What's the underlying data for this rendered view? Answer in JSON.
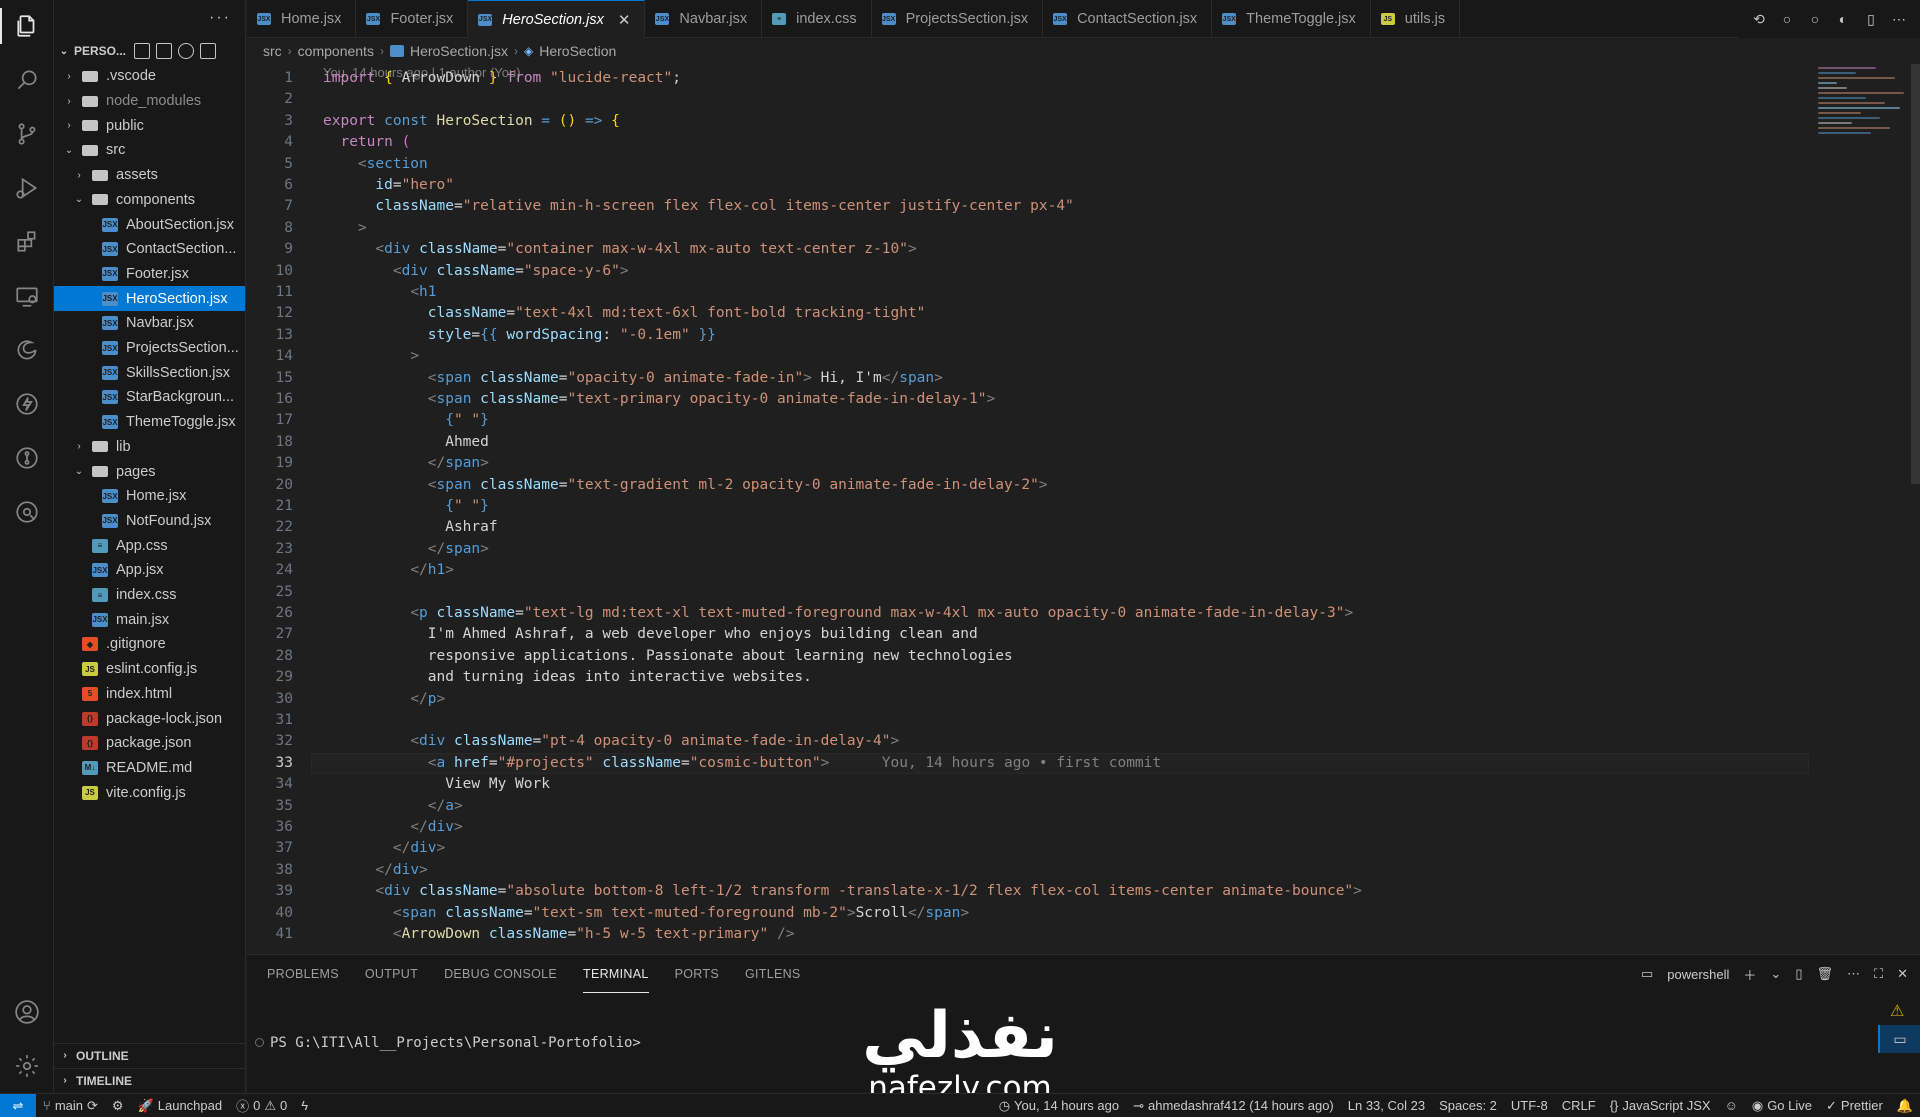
{
  "sidebar": {
    "title_dots": "···",
    "root_label": "PERSO...",
    "tree": [
      {
        "label": ".vscode",
        "kind": "folder",
        "indent": 0,
        "open": false
      },
      {
        "label": "node_modules",
        "kind": "folder",
        "indent": 0,
        "open": false,
        "dim": true
      },
      {
        "label": "public",
        "kind": "folder",
        "indent": 0,
        "open": false
      },
      {
        "label": "src",
        "kind": "folder",
        "indent": 0,
        "open": true
      },
      {
        "label": "assets",
        "kind": "folder",
        "indent": 1,
        "open": false
      },
      {
        "label": "components",
        "kind": "folder",
        "indent": 1,
        "open": true
      },
      {
        "label": "AboutSection.jsx",
        "kind": "jsx",
        "indent": 2
      },
      {
        "label": "ContactSection...",
        "kind": "jsx",
        "indent": 2
      },
      {
        "label": "Footer.jsx",
        "kind": "jsx",
        "indent": 2
      },
      {
        "label": "HeroSection.jsx",
        "kind": "jsx",
        "indent": 2,
        "selected": true
      },
      {
        "label": "Navbar.jsx",
        "kind": "jsx",
        "indent": 2
      },
      {
        "label": "ProjectsSection...",
        "kind": "jsx",
        "indent": 2
      },
      {
        "label": "SkillsSection.jsx",
        "kind": "jsx",
        "indent": 2
      },
      {
        "label": "StarBackgroun...",
        "kind": "jsx",
        "indent": 2
      },
      {
        "label": "ThemeToggle.jsx",
        "kind": "jsx",
        "indent": 2
      },
      {
        "label": "lib",
        "kind": "folder",
        "indent": 1,
        "open": false
      },
      {
        "label": "pages",
        "kind": "folder",
        "indent": 1,
        "open": true
      },
      {
        "label": "Home.jsx",
        "kind": "jsx",
        "indent": 2
      },
      {
        "label": "NotFound.jsx",
        "kind": "jsx",
        "indent": 2
      },
      {
        "label": "App.css",
        "kind": "css",
        "indent": 1
      },
      {
        "label": "App.jsx",
        "kind": "jsx",
        "indent": 1
      },
      {
        "label": "index.css",
        "kind": "css",
        "indent": 1
      },
      {
        "label": "main.jsx",
        "kind": "jsx",
        "indent": 1
      },
      {
        "label": ".gitignore",
        "kind": "git",
        "indent": 0
      },
      {
        "label": "eslint.config.js",
        "kind": "js",
        "indent": 0
      },
      {
        "label": "index.html",
        "kind": "html",
        "indent": 0
      },
      {
        "label": "package-lock.json",
        "kind": "json",
        "indent": 0
      },
      {
        "label": "package.json",
        "kind": "json",
        "indent": 0
      },
      {
        "label": "README.md",
        "kind": "md",
        "indent": 0
      },
      {
        "label": "vite.config.js",
        "kind": "js",
        "indent": 0
      }
    ],
    "outline_label": "OUTLINE",
    "timeline_label": "TIMELINE"
  },
  "tabs": [
    {
      "label": "Home.jsx",
      "kind": "jsx"
    },
    {
      "label": "Footer.jsx",
      "kind": "jsx"
    },
    {
      "label": "HeroSection.jsx",
      "kind": "jsx",
      "active": true
    },
    {
      "label": "Navbar.jsx",
      "kind": "jsx"
    },
    {
      "label": "index.css",
      "kind": "css"
    },
    {
      "label": "ProjectsSection.jsx",
      "kind": "jsx"
    },
    {
      "label": "ContactSection.jsx",
      "kind": "jsx"
    },
    {
      "label": "ThemeToggle.jsx",
      "kind": "jsx"
    },
    {
      "label": "utils.js",
      "kind": "js"
    }
  ],
  "tab_close_glyph": "✕",
  "breadcrumb": {
    "parts": [
      "src",
      "components",
      "HeroSection.jsx",
      "HeroSection"
    ]
  },
  "editor": {
    "blame_header": "You, 14 hours ago | 1 author (You)",
    "current_line": 33,
    "inline_blame": "You, 14 hours ago • first commit",
    "lines": [
      [
        [
          "k",
          "import"
        ],
        [
          "p",
          " "
        ],
        [
          "br",
          "{"
        ],
        [
          "p",
          " ArrowDown "
        ],
        [
          "br",
          "}"
        ],
        [
          "p",
          " "
        ],
        [
          "k",
          "from"
        ],
        [
          "p",
          " "
        ],
        [
          "s",
          "\"lucide-react\""
        ],
        [
          "p",
          ";"
        ]
      ],
      [],
      [
        [
          "k",
          "export"
        ],
        [
          "p",
          " "
        ],
        [
          "b",
          "const"
        ],
        [
          "p",
          " "
        ],
        [
          "f",
          "HeroSection"
        ],
        [
          "p",
          " "
        ],
        [
          "b",
          "="
        ],
        [
          "p",
          " "
        ],
        [
          "br",
          "()"
        ],
        [
          "p",
          " "
        ],
        [
          "b",
          "=>"
        ],
        [
          "p",
          " "
        ],
        [
          "br",
          "{"
        ]
      ],
      [
        [
          "p",
          "  "
        ],
        [
          "k",
          "return"
        ],
        [
          "p",
          " "
        ],
        [
          "brp",
          "("
        ]
      ],
      [
        [
          "p",
          "    "
        ],
        [
          "tg",
          "<"
        ],
        [
          "t",
          "section"
        ]
      ],
      [
        [
          "p",
          "      "
        ],
        [
          "a",
          "id"
        ],
        [
          "p",
          "="
        ],
        [
          "s",
          "\"hero\""
        ]
      ],
      [
        [
          "p",
          "      "
        ],
        [
          "a",
          "className"
        ],
        [
          "p",
          "="
        ],
        [
          "s",
          "\"relative min-h-screen flex flex-col items-center justify-center px-4\""
        ]
      ],
      [
        [
          "p",
          "    "
        ],
        [
          "tg",
          ">"
        ]
      ],
      [
        [
          "p",
          "      "
        ],
        [
          "tg",
          "<"
        ],
        [
          "t",
          "div"
        ],
        [
          "p",
          " "
        ],
        [
          "a",
          "className"
        ],
        [
          "p",
          "="
        ],
        [
          "s",
          "\"container max-w-4xl mx-auto text-center z-10\""
        ],
        [
          "tg",
          ">"
        ]
      ],
      [
        [
          "p",
          "        "
        ],
        [
          "tg",
          "<"
        ],
        [
          "t",
          "div"
        ],
        [
          "p",
          " "
        ],
        [
          "a",
          "className"
        ],
        [
          "p",
          "="
        ],
        [
          "s",
          "\"space-y-6\""
        ],
        [
          "tg",
          ">"
        ]
      ],
      [
        [
          "p",
          "          "
        ],
        [
          "tg",
          "<"
        ],
        [
          "t",
          "h1"
        ]
      ],
      [
        [
          "p",
          "            "
        ],
        [
          "a",
          "className"
        ],
        [
          "p",
          "="
        ],
        [
          "s",
          "\"text-4xl md:text-6xl font-bold tracking-tight\""
        ]
      ],
      [
        [
          "p",
          "            "
        ],
        [
          "a",
          "style"
        ],
        [
          "p",
          "="
        ],
        [
          "b",
          "{{"
        ],
        [
          "p",
          " "
        ],
        [
          "a",
          "wordSpacing"
        ],
        [
          "p",
          ": "
        ],
        [
          "s",
          "\"-0.1em\""
        ],
        [
          "p",
          " "
        ],
        [
          "b",
          "}}"
        ]
      ],
      [
        [
          "p",
          "          "
        ],
        [
          "tg",
          ">"
        ]
      ],
      [
        [
          "p",
          "            "
        ],
        [
          "tg",
          "<"
        ],
        [
          "t",
          "span"
        ],
        [
          "p",
          " "
        ],
        [
          "a",
          "className"
        ],
        [
          "p",
          "="
        ],
        [
          "s",
          "\"opacity-0 animate-fade-in\""
        ],
        [
          "tg",
          ">"
        ],
        [
          "x",
          " Hi, I'm"
        ],
        [
          "tg",
          "</"
        ],
        [
          "t",
          "span"
        ],
        [
          "tg",
          ">"
        ]
      ],
      [
        [
          "p",
          "            "
        ],
        [
          "tg",
          "<"
        ],
        [
          "t",
          "span"
        ],
        [
          "p",
          " "
        ],
        [
          "a",
          "className"
        ],
        [
          "p",
          "="
        ],
        [
          "s",
          "\"text-primary opacity-0 animate-fade-in-delay-1\""
        ],
        [
          "tg",
          ">"
        ]
      ],
      [
        [
          "p",
          "              "
        ],
        [
          "b",
          "{"
        ],
        [
          "s",
          "\" \""
        ],
        [
          "b",
          "}"
        ]
      ],
      [
        [
          "x",
          "              Ahmed"
        ]
      ],
      [
        [
          "p",
          "            "
        ],
        [
          "tg",
          "</"
        ],
        [
          "t",
          "span"
        ],
        [
          "tg",
          ">"
        ]
      ],
      [
        [
          "p",
          "            "
        ],
        [
          "tg",
          "<"
        ],
        [
          "t",
          "span"
        ],
        [
          "p",
          " "
        ],
        [
          "a",
          "className"
        ],
        [
          "p",
          "="
        ],
        [
          "s",
          "\"text-gradient ml-2 opacity-0 animate-fade-in-delay-2\""
        ],
        [
          "tg",
          ">"
        ]
      ],
      [
        [
          "p",
          "              "
        ],
        [
          "b",
          "{"
        ],
        [
          "s",
          "\" \""
        ],
        [
          "b",
          "}"
        ]
      ],
      [
        [
          "x",
          "              Ashraf"
        ]
      ],
      [
        [
          "p",
          "            "
        ],
        [
          "tg",
          "</"
        ],
        [
          "t",
          "span"
        ],
        [
          "tg",
          ">"
        ]
      ],
      [
        [
          "p",
          "          "
        ],
        [
          "tg",
          "</"
        ],
        [
          "t",
          "h1"
        ],
        [
          "tg",
          ">"
        ]
      ],
      [],
      [
        [
          "p",
          "          "
        ],
        [
          "tg",
          "<"
        ],
        [
          "t",
          "p"
        ],
        [
          "p",
          " "
        ],
        [
          "a",
          "className"
        ],
        [
          "p",
          "="
        ],
        [
          "s",
          "\"text-lg md:text-xl text-muted-foreground max-w-4xl mx-auto opacity-0 animate-fade-in-delay-3\""
        ],
        [
          "tg",
          ">"
        ]
      ],
      [
        [
          "x",
          "            I'm Ahmed Ashraf, a web developer who enjoys building clean and"
        ]
      ],
      [
        [
          "x",
          "            responsive applications. Passionate about learning new technologies"
        ]
      ],
      [
        [
          "x",
          "            and turning ideas into interactive websites."
        ]
      ],
      [
        [
          "p",
          "          "
        ],
        [
          "tg",
          "</"
        ],
        [
          "t",
          "p"
        ],
        [
          "tg",
          ">"
        ]
      ],
      [],
      [
        [
          "p",
          "          "
        ],
        [
          "tg",
          "<"
        ],
        [
          "t",
          "div"
        ],
        [
          "p",
          " "
        ],
        [
          "a",
          "className"
        ],
        [
          "p",
          "="
        ],
        [
          "s",
          "\"pt-4 opacity-0 animate-fade-in-delay-4\""
        ],
        [
          "tg",
          ">"
        ]
      ],
      [
        [
          "p",
          "            "
        ],
        [
          "tg",
          "<"
        ],
        [
          "t",
          "a"
        ],
        [
          "p",
          " "
        ],
        [
          "a",
          "href"
        ],
        [
          "p",
          "="
        ],
        [
          "s",
          "\"#projects\""
        ],
        [
          "p",
          " "
        ],
        [
          "a",
          "className"
        ],
        [
          "p",
          "="
        ],
        [
          "s",
          "\"cosmic-button\""
        ],
        [
          "tg",
          ">"
        ]
      ],
      [
        [
          "x",
          "              View My Work"
        ]
      ],
      [
        [
          "p",
          "            "
        ],
        [
          "tg",
          "</"
        ],
        [
          "t",
          "a"
        ],
        [
          "tg",
          ">"
        ]
      ],
      [
        [
          "p",
          "          "
        ],
        [
          "tg",
          "</"
        ],
        [
          "t",
          "div"
        ],
        [
          "tg",
          ">"
        ]
      ],
      [
        [
          "p",
          "        "
        ],
        [
          "tg",
          "</"
        ],
        [
          "t",
          "div"
        ],
        [
          "tg",
          ">"
        ]
      ],
      [
        [
          "p",
          "      "
        ],
        [
          "tg",
          "</"
        ],
        [
          "t",
          "div"
        ],
        [
          "tg",
          ">"
        ]
      ],
      [
        [
          "p",
          "      "
        ],
        [
          "tg",
          "<"
        ],
        [
          "t",
          "div"
        ],
        [
          "p",
          " "
        ],
        [
          "a",
          "className"
        ],
        [
          "p",
          "="
        ],
        [
          "s",
          "\"absolute bottom-8 left-1/2 transform -translate-x-1/2 flex flex-col items-center animate-bounce\""
        ],
        [
          "tg",
          ">"
        ]
      ],
      [
        [
          "p",
          "        "
        ],
        [
          "tg",
          "<"
        ],
        [
          "t",
          "span"
        ],
        [
          "p",
          " "
        ],
        [
          "a",
          "className"
        ],
        [
          "p",
          "="
        ],
        [
          "s",
          "\"text-sm text-muted-foreground mb-2\""
        ],
        [
          "tg",
          ">"
        ],
        [
          "x",
          "Scroll"
        ],
        [
          "tg",
          "</"
        ],
        [
          "t",
          "span"
        ],
        [
          "tg",
          ">"
        ]
      ],
      [
        [
          "p",
          "        "
        ],
        [
          "tg",
          "<"
        ],
        [
          "f",
          "ArrowDown"
        ],
        [
          "p",
          " "
        ],
        [
          "a",
          "className"
        ],
        [
          "p",
          "="
        ],
        [
          "s",
          "\"h-5 w-5 text-primary\""
        ],
        [
          "p",
          " "
        ],
        [
          "tg",
          "/>"
        ]
      ]
    ]
  },
  "panel": {
    "tabs": [
      "PROBLEMS",
      "OUTPUT",
      "DEBUG CONSOLE",
      "TERMINAL",
      "PORTS",
      "GITLENS"
    ],
    "active_tab": "TERMINAL",
    "shell_label": "powershell",
    "terminal_prompt": "PS G:\\ITI\\All__Projects\\Personal-Portofolio>"
  },
  "watermark": {
    "arabic": "نفذلي",
    "latin": "nafezly.com"
  },
  "status": {
    "branch": "main",
    "launchpad": "Launchpad",
    "errors": "0",
    "warnings": "0",
    "blame": "You, 14 hours ago",
    "author": "ahmedashraf412 (14 hours ago)",
    "position": "Ln 33, Col 23",
    "spaces": "Spaces: 2",
    "encoding": "UTF-8",
    "eol": "CRLF",
    "language": "JavaScript JSX",
    "golive": "Go Live",
    "prettier": "Prettier"
  },
  "colors": {
    "accent": "#0078d4",
    "jsx_icon": "#4b8ec9",
    "css_icon": "#519aba",
    "js_icon": "#cbcb41",
    "git_icon": "#e44d26",
    "html_icon": "#e44d26",
    "json_icon": "#c0392b",
    "md_icon": "#519aba"
  }
}
